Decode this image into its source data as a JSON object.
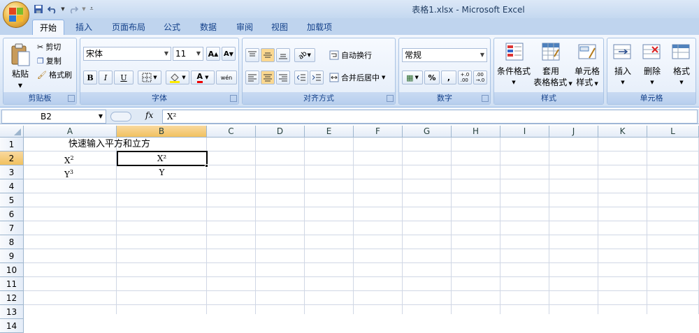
{
  "window": {
    "title": "表格1.xlsx - Microsoft Excel"
  },
  "tabs": [
    "开始",
    "插入",
    "页面布局",
    "公式",
    "数据",
    "审阅",
    "视图",
    "加载项"
  ],
  "clipboard": {
    "paste": "粘贴",
    "cut": "剪切",
    "copy": "复制",
    "format_painter": "格式刷",
    "label": "剪贴板"
  },
  "font": {
    "name": "宋体",
    "size": "11",
    "bold": "B",
    "italic": "I",
    "underline": "U",
    "label": "字体",
    "phonetic": "wén"
  },
  "alignment": {
    "wrap": "自动换行",
    "merge": "合并后居中",
    "label": "对齐方式"
  },
  "number": {
    "format": "常规",
    "percent": "%",
    "comma": ",",
    "label": "数字"
  },
  "styles": {
    "conditional": "条件格式",
    "table_a": "套用",
    "table_b": "表格格式",
    "cell_a": "单元格",
    "cell_b": "样式",
    "label": "样式"
  },
  "cells_group": {
    "insert": "插入",
    "delete": "删除",
    "format": "格式",
    "label": "单元格"
  },
  "formula_bar": {
    "name_box": "B2",
    "fx": "fx",
    "content": "X²"
  },
  "columns": [
    "A",
    "B",
    "C",
    "D",
    "E",
    "F",
    "G",
    "H",
    "I",
    "J",
    "K",
    "L"
  ],
  "rows": [
    "1",
    "2",
    "3",
    "4",
    "5",
    "6",
    "7",
    "8",
    "9",
    "10",
    "11",
    "12",
    "13",
    "14"
  ],
  "cells": {
    "A1": "快速输入平方和立方",
    "A2_base": "X",
    "A2_sup": "2",
    "A3_base": "Y",
    "A3_sup": "3",
    "B2": "X²",
    "B3": "Y"
  },
  "colors": {
    "accent": "#15428b",
    "selected_header": "#f1c15f",
    "grid": "#d0d7e5"
  }
}
